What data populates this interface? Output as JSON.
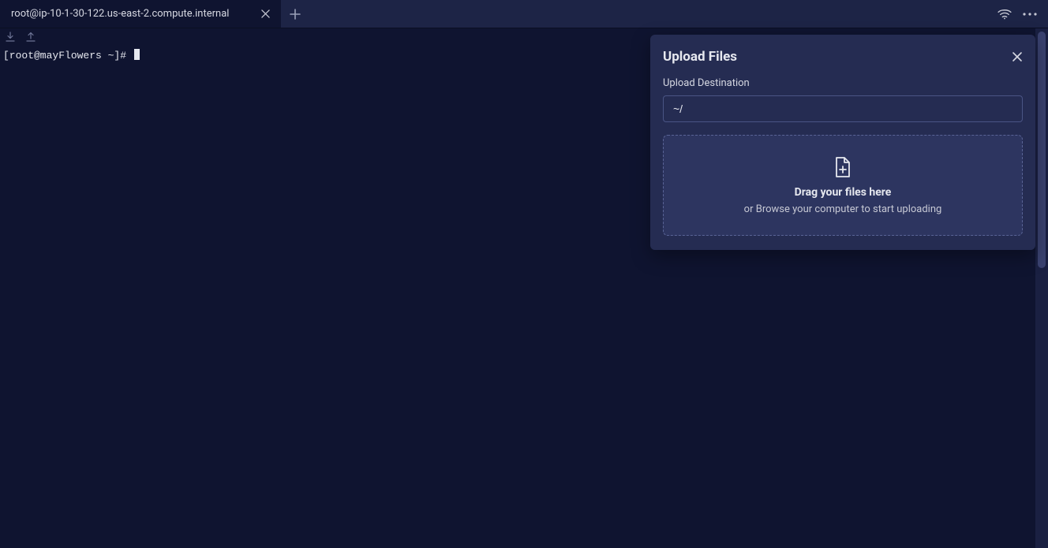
{
  "tabs": {
    "active_title": "root@ip-10-1-30-122.us-east-2.compute.internal"
  },
  "terminal": {
    "prompt": "[root@mayFlowers ~]# "
  },
  "upload_panel": {
    "title": "Upload Files",
    "destination_label": "Upload Destination",
    "destination_value": "~/",
    "dropzone_main": "Drag your files here",
    "dropzone_sub": "or Browse your computer to start uploading"
  }
}
